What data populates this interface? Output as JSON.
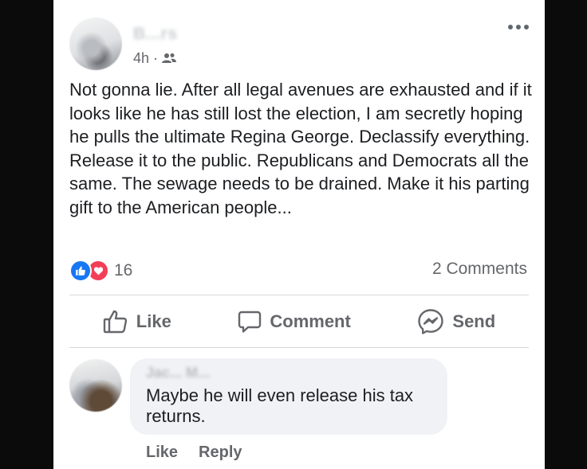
{
  "post": {
    "author": "B...rs",
    "time": "4h",
    "audience_icon": "friends-icon",
    "text": "Not gonna lie. After all legal avenues are exhausted and if it looks like he has still lost the election, I am secretly hoping he pulls the ultimate Regina George. Declassify everything. Release it to the public. Republicans and Democrats all the same.  The sewage needs to be drained. Make it his parting gift to the American people...",
    "reactions": {
      "types": [
        "like",
        "love"
      ],
      "count": "16"
    },
    "comments_count": "2 Comments"
  },
  "actions": {
    "like": "Like",
    "comment": "Comment",
    "send": "Send"
  },
  "comment": {
    "author": "Jac... M...",
    "text": "Maybe he will even release his tax returns.",
    "like": "Like",
    "reply": "Reply"
  },
  "colors": {
    "like_blue": "#1877f2",
    "love_red": "#f33e58",
    "text": "#1c1e21",
    "muted": "#65676b",
    "bubble": "#f0f2f5"
  }
}
